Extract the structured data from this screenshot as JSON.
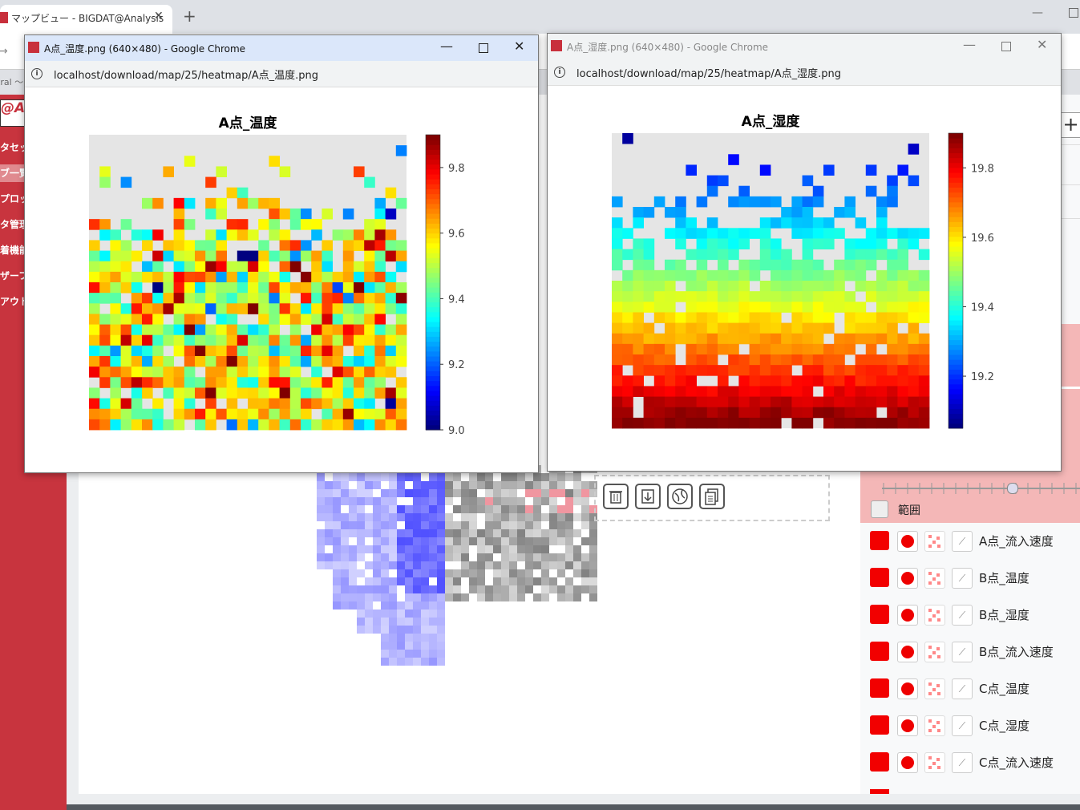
{
  "browser": {
    "tab_title": "マップビュー - BIGDAT@Analysis",
    "tab_close": "✕",
    "new_tab": "+",
    "minimize": "—",
    "bookmark_partial": "tral 〜",
    "back_arrow": "→"
  },
  "app": {
    "logo_text": "@An",
    "sidebar_items": [
      {
        "label": "タセッ"
      },
      {
        "label": "ブ一覧"
      },
      {
        "label": "プロッ"
      },
      {
        "label": "タ管理"
      },
      {
        "label": "着機能"
      },
      {
        "label": "ザーフ"
      },
      {
        "label": "アウト"
      }
    ]
  },
  "popup1": {
    "window_title": "A点_温度.png (640×480) - Google Chrome",
    "url": "localhost/download/map/25/heatmap/A点_温度.png"
  },
  "popup2": {
    "window_title": "A点_湿度.png (640×480) - Google Chrome",
    "url": "localhost/download/map/25/heatmap/A点_湿度.png"
  },
  "window_controls": {
    "minimize": "—",
    "close": "✕"
  },
  "right_panel": {
    "plus": "+",
    "range_label": "範囲",
    "slider_position": 0.66,
    "layers": [
      {
        "label": "A点_流入速度"
      },
      {
        "label": "B点_温度"
      },
      {
        "label": "B点_湿度"
      },
      {
        "label": "B点_流入速度"
      },
      {
        "label": "C点_温度"
      },
      {
        "label": "C点_湿度"
      },
      {
        "label": "C点_流入速度"
      }
    ],
    "swatch_color": "#f20000"
  },
  "chart_data": [
    {
      "type": "heatmap",
      "title": "A点_温度",
      "colormap": "jet",
      "colorbar_range": [
        9.0,
        9.9
      ],
      "colorbar_ticks": [
        "9.0",
        "9.2",
        "9.4",
        "9.6",
        "9.8"
      ],
      "grid_size": [
        30,
        28
      ],
      "background": "#e5e5e5",
      "pattern": "random noise, mostly 9.3–9.6, sparse cells in upper rows, dense in lower rows"
    },
    {
      "type": "heatmap",
      "title": "A点_湿度",
      "colormap": "jet",
      "colorbar_range": [
        19.05,
        19.9
      ],
      "colorbar_ticks": [
        "19.2",
        "19.4",
        "19.6",
        "19.8"
      ],
      "grid_size": [
        30,
        28
      ],
      "background": "#e5e5e5",
      "pattern": "vertical gradient: ~19.1 at top rows to ~19.9 at bottom rows"
    }
  ]
}
